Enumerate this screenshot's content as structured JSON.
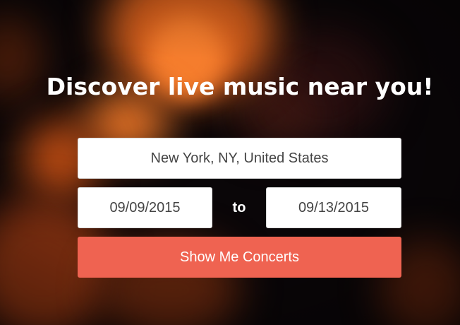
{
  "hero": {
    "headline": "Discover live music near you!"
  },
  "search": {
    "location_value": "New York, NY, United States",
    "start_date_value": "09/09/2015",
    "range_separator": "to",
    "end_date_value": "09/13/2015",
    "submit_label": "Show Me Concerts"
  },
  "colors": {
    "button_accent": "#ef6351",
    "input_background": "#ffffff",
    "headline_text": "#ffffff"
  }
}
